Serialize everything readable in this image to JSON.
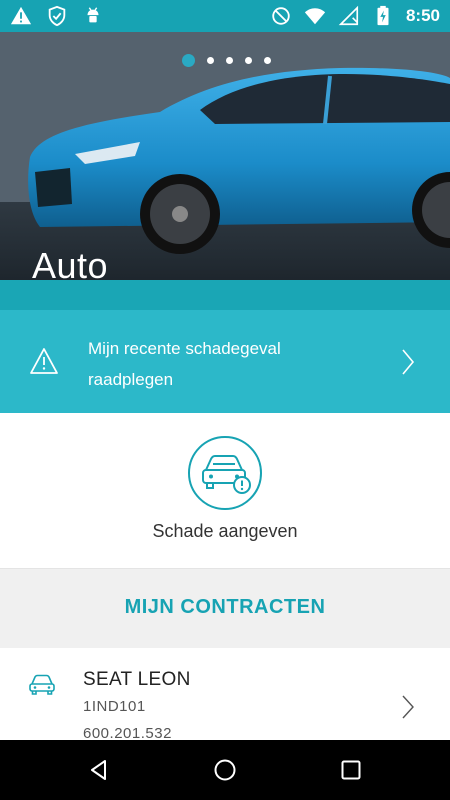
{
  "status_bar": {
    "time": "8:50",
    "left_icons": [
      "warning-icon",
      "shield-check-icon",
      "android-debug-icon"
    ],
    "right_icons": [
      "do-not-disturb-icon",
      "wifi-icon",
      "signal-icon",
      "battery-charging-icon"
    ]
  },
  "hero": {
    "title": "Auto",
    "carousel_pages": 5,
    "active_page": 1
  },
  "recent_claim": {
    "label": "Mijn recente schadegeval raadplegen"
  },
  "report_damage": {
    "label": "Schade aangeven"
  },
  "contracts": {
    "title": "MIJN CONTRACTEN",
    "items": [
      {
        "name": "SEAT LEON",
        "plate": "1IND101",
        "number": "600.201.532"
      }
    ]
  },
  "colors": {
    "accent": "#17a3b3",
    "claim_row": "#2cb8c9",
    "section_bg": "#f0f0f0"
  }
}
